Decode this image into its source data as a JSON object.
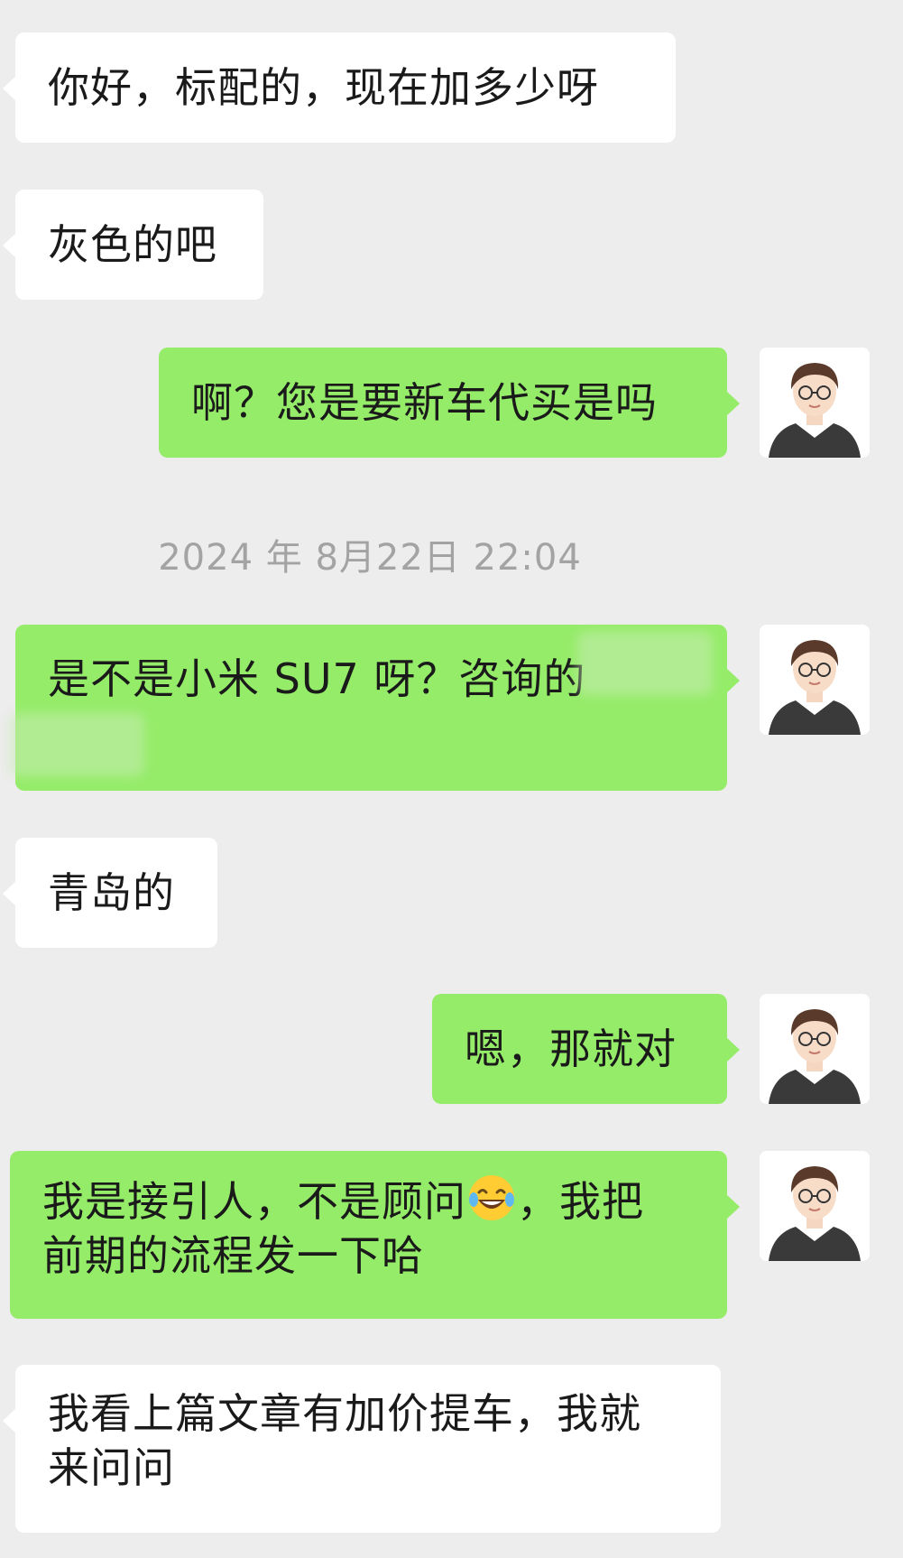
{
  "conversation": {
    "messages": [
      {
        "id": "m1",
        "side": "incoming",
        "lines": [
          "你好，标配的，现在加多少呀"
        ]
      },
      {
        "id": "m2",
        "side": "incoming",
        "lines": [
          "灰色的吧"
        ]
      },
      {
        "id": "m3",
        "side": "outgoing",
        "lines": [
          "啊？您是要新车代买是吗"
        ]
      },
      {
        "id": "m4",
        "side": "outgoing",
        "lines": [
          "是不是小米 SU7 呀？咨询的"
        ]
      },
      {
        "id": "m5",
        "side": "incoming",
        "lines": [
          "青岛的"
        ]
      },
      {
        "id": "m6",
        "side": "outgoing",
        "lines": [
          "嗯，那就对"
        ]
      },
      {
        "id": "m7",
        "side": "outgoing",
        "line1_before_emoji": "我是接引人，不是顾问",
        "line1_after_emoji": "，我把",
        "line2": "前期的流程发一下哈",
        "emoji": "laughing-tears-emoji"
      },
      {
        "id": "m8",
        "side": "incoming",
        "lines": [
          "我看上篇文章有加价提车，我就",
          "来问问"
        ]
      }
    ],
    "timestamp": "2024 年 8月22日 22:04"
  },
  "colors": {
    "background": "#ededed",
    "incoming_bubble": "#ffffff",
    "outgoing_bubble": "#95ec69",
    "timestamp_text": "#a3a3a3"
  },
  "icons": {
    "avatar": "cartoon-man-glasses-suit-avatar"
  }
}
